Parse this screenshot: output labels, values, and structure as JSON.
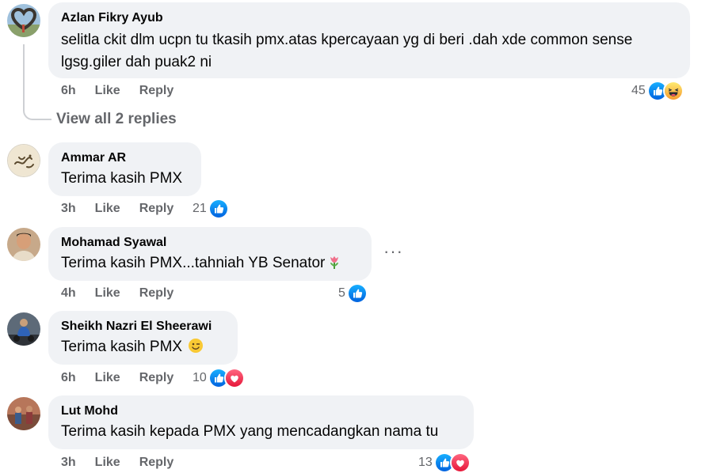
{
  "comments": [
    {
      "author": "Azlan Fikry Ayub",
      "text": "selitla ckit dlm ucpn tu tkasih pmx.atas kpercayaan yg di beri .dah xde common sense lgsg.giler dah puak2 ni",
      "time": "6h",
      "like": "Like",
      "reply": "Reply",
      "reaction_count": "45",
      "reactions": [
        "like-icon",
        "laugh-icon"
      ]
    },
    {
      "author": "Ammar AR",
      "text": "Terima kasih PMX",
      "time": "3h",
      "like": "Like",
      "reply": "Reply",
      "reaction_count": "21",
      "reactions": [
        "like-icon"
      ]
    },
    {
      "author": "Mohamad Syawal",
      "text": "Terima kasih PMX...tahniah YB Senator",
      "text_emoji": "tulip-emoji",
      "time": "4h",
      "like": "Like",
      "reply": "Reply",
      "reaction_count": "5",
      "reactions": [
        "like-icon"
      ]
    },
    {
      "author": "Sheikh Nazri El Sheerawi",
      "text": "Terima kasih PMX",
      "text_emoji": "wink-emoji",
      "time": "6h",
      "like": "Like",
      "reply": "Reply",
      "reaction_count": "10",
      "reactions": [
        "like-icon",
        "love-icon"
      ]
    },
    {
      "author": "Lut Mohd",
      "text": "Terima kasih kepada PMX yang mencadangkan nama tu",
      "time": "3h",
      "like": "Like",
      "reply": "Reply",
      "reaction_count": "13",
      "reactions": [
        "like-icon",
        "love-icon"
      ]
    }
  ],
  "view_replies": "View all 2 replies",
  "more_options": "···",
  "colors": {
    "bubble": "#f0f2f5",
    "secondary_text": "#65676b",
    "like_blue": "#1877f2",
    "love_red": "#f33e58",
    "laugh_yellow": "#f7b125"
  }
}
